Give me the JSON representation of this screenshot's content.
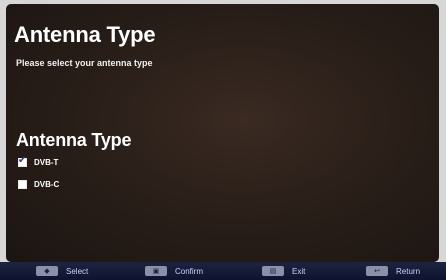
{
  "screen": {
    "title": "Antenna Type",
    "subtitle": "Please select your antenna type",
    "section_title": "Antenna Type",
    "options": [
      {
        "label": "DVB-T",
        "checked": true
      },
      {
        "label": "DVB-C",
        "checked": false
      }
    ]
  },
  "hints": [
    {
      "icon": "dpad-icon",
      "label": "Select"
    },
    {
      "icon": "ok-key-icon",
      "label": "Confirm"
    },
    {
      "icon": "exit-key-icon",
      "label": "Exit"
    },
    {
      "icon": "back-key-icon",
      "label": "Return"
    }
  ],
  "colors": {
    "background": "#2a1f19",
    "text": "#ffffff",
    "hint_bar": "#141a35",
    "hint_text": "#c9d1ff",
    "check": "#2f3a8a"
  }
}
